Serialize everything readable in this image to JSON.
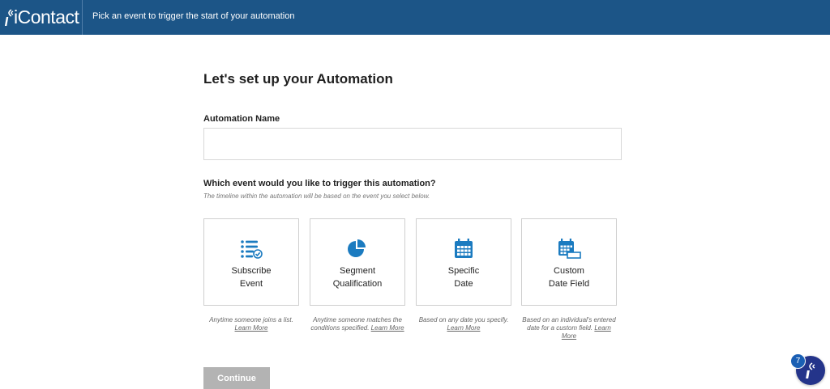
{
  "header": {
    "logo_text": "iContact",
    "title": "Pick an event to trigger the start of your automation"
  },
  "form": {
    "heading": "Let's set up your Automation",
    "name_label": "Automation Name",
    "name_value": "",
    "question": "Which event would you like to trigger this automation?",
    "hint": "The timeline within the automation will be based on the event you select below."
  },
  "events": [
    {
      "line1": "Subscribe",
      "line2": "Event",
      "desc": "Anytime someone joins a list.",
      "link": "Learn More",
      "icon": "list-check-icon"
    },
    {
      "line1": "Segment",
      "line2": "Qualification",
      "desc": "Anytime someone matches the conditions specified.",
      "link": "Learn More",
      "icon": "pie-chart-icon"
    },
    {
      "line1": "Specific",
      "line2": "Date",
      "desc": "Based on any date you specify.",
      "link": "Learn More",
      "icon": "calendar-icon"
    },
    {
      "line1": "Custom",
      "line2": "Date Field",
      "desc": "Based on an individual's entered date for a custom field.",
      "link": "Learn More",
      "icon": "calendar-field-icon"
    }
  ],
  "continue_label": "Continue",
  "help": {
    "badge_count": "7"
  },
  "colors": {
    "brand": "#1c5587",
    "accent": "#1b7bc0",
    "button_disabled": "#b3b3b3"
  }
}
